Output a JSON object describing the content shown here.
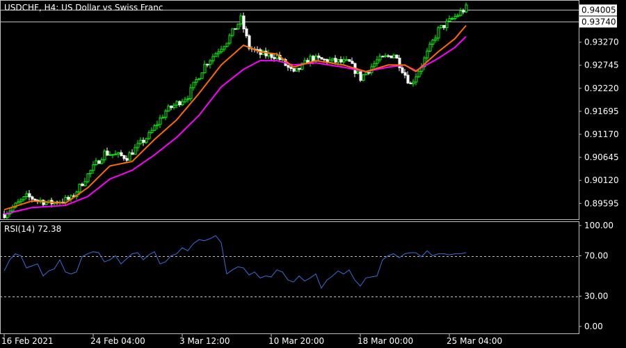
{
  "header": {
    "symbol_label": "USDCHF, H4:  US Dollar vs Swiss Franc"
  },
  "indicator": {
    "label": "RSI(14) 72.38"
  },
  "colors": {
    "background": "#000000",
    "bull_candle": "#00ff00",
    "bear_candle": "#ffffff",
    "ma_fast": "#ff6a00",
    "ma_slow": "#ff00ff",
    "rsi_line": "#3a6fd8",
    "level_line": "#c0c0c0"
  },
  "chart_data": [
    {
      "type": "candlestick",
      "price_axis": {
        "range": [
          0.8925,
          0.942
        ],
        "ticks": [
          "0.93270",
          "0.92745",
          "0.92220",
          "0.91695",
          "0.91170",
          "0.90645",
          "0.90120",
          "0.89595"
        ],
        "tick_values": [
          0.9327,
          0.92745,
          0.9222,
          0.91695,
          0.9117,
          0.90645,
          0.9012,
          0.89595
        ],
        "highlight_labels": [
          {
            "text": "0.94005",
            "value": 0.94005
          },
          {
            "text": "0.93740",
            "value": 0.9374
          }
        ]
      },
      "time_axis": {
        "labels": [
          "16 Feb 2021",
          "24 Feb 04:00",
          "3 Mar 12:00",
          "10 Mar 20:00",
          "18 Mar 00:00",
          "25 Mar 04:00"
        ],
        "label_bars": [
          0,
          32,
          64,
          96,
          128,
          160
        ]
      },
      "close_path": [
        [
          0,
          0.8935
        ],
        [
          8,
          0.8975
        ],
        [
          16,
          0.896
        ],
        [
          24,
          0.897
        ],
        [
          30,
          0.9025
        ],
        [
          36,
          0.9075
        ],
        [
          44,
          0.9065
        ],
        [
          52,
          0.9115
        ],
        [
          58,
          0.917
        ],
        [
          66,
          0.9205
        ],
        [
          72,
          0.9275
        ],
        [
          80,
          0.933
        ],
        [
          85,
          0.938
        ],
        [
          88,
          0.9315
        ],
        [
          92,
          0.93
        ],
        [
          98,
          0.9295
        ],
        [
          104,
          0.9255
        ],
        [
          110,
          0.929
        ],
        [
          116,
          0.9285
        ],
        [
          124,
          0.928
        ],
        [
          128,
          0.9245
        ],
        [
          134,
          0.9285
        ],
        [
          140,
          0.93
        ],
        [
          146,
          0.923
        ],
        [
          150,
          0.9275
        ],
        [
          156,
          0.9355
        ],
        [
          162,
          0.9385
        ],
        [
          166,
          0.9405
        ]
      ],
      "ma_fast_path": [
        [
          0,
          0.8945
        ],
        [
          10,
          0.8965
        ],
        [
          22,
          0.896
        ],
        [
          30,
          0.8995
        ],
        [
          38,
          0.9045
        ],
        [
          46,
          0.9055
        ],
        [
          54,
          0.9105
        ],
        [
          62,
          0.915
        ],
        [
          70,
          0.921
        ],
        [
          78,
          0.9275
        ],
        [
          86,
          0.932
        ],
        [
          92,
          0.9305
        ],
        [
          98,
          0.93
        ],
        [
          104,
          0.927
        ],
        [
          112,
          0.9285
        ],
        [
          122,
          0.9275
        ],
        [
          130,
          0.926
        ],
        [
          138,
          0.9275
        ],
        [
          144,
          0.9275
        ],
        [
          148,
          0.926
        ],
        [
          156,
          0.9305
        ],
        [
          162,
          0.9335
        ],
        [
          166,
          0.9365
        ]
      ],
      "ma_slow_path": [
        [
          0,
          0.8935
        ],
        [
          10,
          0.895
        ],
        [
          22,
          0.8955
        ],
        [
          30,
          0.8975
        ],
        [
          38,
          0.9015
        ],
        [
          46,
          0.9035
        ],
        [
          54,
          0.907
        ],
        [
          62,
          0.911
        ],
        [
          70,
          0.916
        ],
        [
          78,
          0.9225
        ],
        [
          86,
          0.9265
        ],
        [
          92,
          0.9285
        ],
        [
          98,
          0.9285
        ],
        [
          104,
          0.9275
        ],
        [
          112,
          0.928
        ],
        [
          122,
          0.927
        ],
        [
          130,
          0.926
        ],
        [
          138,
          0.927
        ],
        [
          144,
          0.9275
        ],
        [
          148,
          0.9262
        ],
        [
          156,
          0.929
        ],
        [
          162,
          0.9315
        ],
        [
          166,
          0.934
        ]
      ]
    },
    {
      "type": "line",
      "name": "RSI(14)",
      "y_axis": {
        "range": [
          0,
          100
        ],
        "ticks": [
          "100.00",
          "70.00",
          "30.00",
          "0.00"
        ],
        "tick_values": [
          100,
          70,
          30,
          0
        ]
      },
      "levels": [
        70,
        30
      ],
      "bars": [
        0,
        2,
        4,
        6,
        8,
        10,
        12,
        14,
        16,
        18,
        20,
        22,
        24,
        26,
        28,
        30,
        32,
        34,
        36,
        38,
        40,
        42,
        44,
        46,
        48,
        50,
        52,
        54,
        56,
        58,
        60,
        62,
        64,
        66,
        68,
        70,
        72,
        74,
        76,
        78,
        80,
        82,
        84,
        86,
        88,
        90,
        92,
        94,
        96,
        98,
        100,
        102,
        104,
        106,
        108,
        110,
        112,
        114,
        116,
        118,
        120,
        122,
        124,
        126,
        128,
        130,
        132,
        134,
        136,
        138,
        140,
        142,
        144,
        146,
        148,
        150,
        152,
        154,
        156,
        158,
        160,
        162,
        164,
        166
      ],
      "values": [
        55,
        66,
        72,
        70,
        58,
        60,
        62,
        50,
        55,
        57,
        66,
        54,
        52,
        54,
        69,
        72,
        74,
        73,
        64,
        66,
        70,
        62,
        67,
        72,
        73,
        66,
        71,
        74,
        62,
        64,
        70,
        72,
        78,
        75,
        82,
        86,
        85,
        87,
        90,
        83,
        52,
        56,
        59,
        58,
        51,
        54,
        48,
        50,
        49,
        56,
        54,
        46,
        44,
        50,
        45,
        48,
        52,
        38,
        46,
        50,
        55,
        52,
        56,
        46,
        40,
        48,
        49,
        50,
        66,
        70,
        72,
        68,
        72,
        73,
        73,
        69,
        75,
        70,
        72,
        72,
        71,
        72,
        72,
        73
      ]
    }
  ]
}
